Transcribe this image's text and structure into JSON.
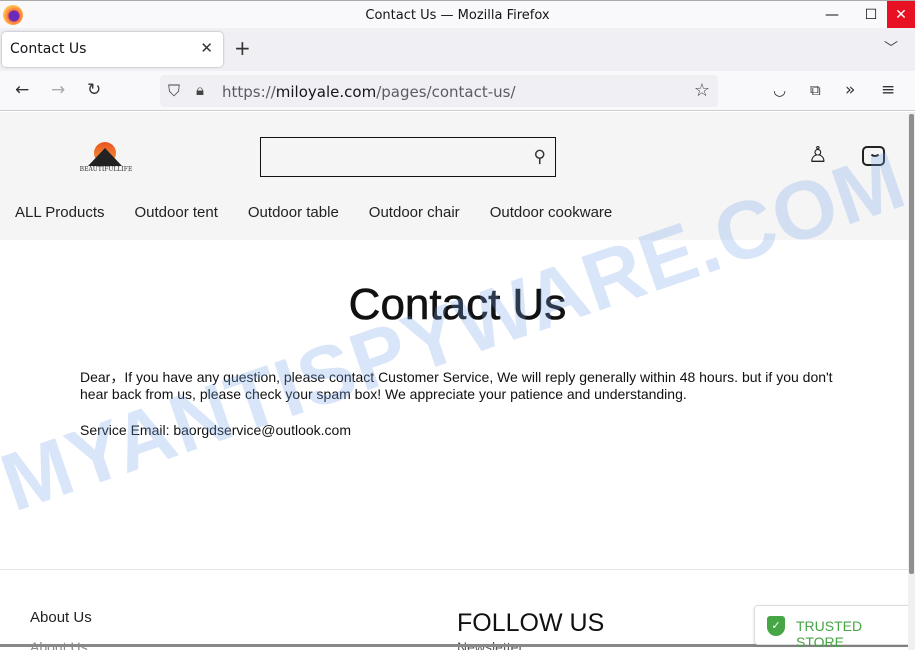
{
  "window": {
    "title": "Contact Us — Mozilla Firefox",
    "controls": {
      "minimize": "—",
      "maximize": "☐",
      "close": "✕"
    }
  },
  "tabs": [
    {
      "label": "Contact Us",
      "active": true
    }
  ],
  "toolbar": {
    "back": "←",
    "forward": "→",
    "reload": "↻",
    "url_scheme": "https://",
    "url_domain": "miloyale.com",
    "url_path": "/pages/contact-us/",
    "icons": [
      "shield-icon",
      "lock-icon",
      "bookmark-star-icon",
      "pocket-icon",
      "extensions-icon",
      "overflow-icon",
      "menu-icon"
    ]
  },
  "site": {
    "logo_text": "BEAUTIFULLIFE",
    "search": {
      "value": "",
      "placeholder": ""
    },
    "nav": [
      "ALL Products",
      "Outdoor tent",
      "Outdoor table",
      "Outdoor chair",
      "Outdoor cookware"
    ]
  },
  "content": {
    "heading": "Contact Us",
    "paragraph": "Dear，If you have any question, please contact Customer Service, We will reply generally within 48 hours. but if you don't hear back from us, please check your spam box! We appreciate your patience and understanding.",
    "email_line": "Service Email: baorgdservice@outlook.com"
  },
  "footer": {
    "about_heading": "About Us",
    "about_link": "About Us",
    "follow_heading": "FOLLOW US",
    "newsletter": "Newsletter"
  },
  "badge": {
    "label": "TRUSTED STORE",
    "color": "#46a545"
  },
  "watermark": "MYANTISPYWARE.COM"
}
